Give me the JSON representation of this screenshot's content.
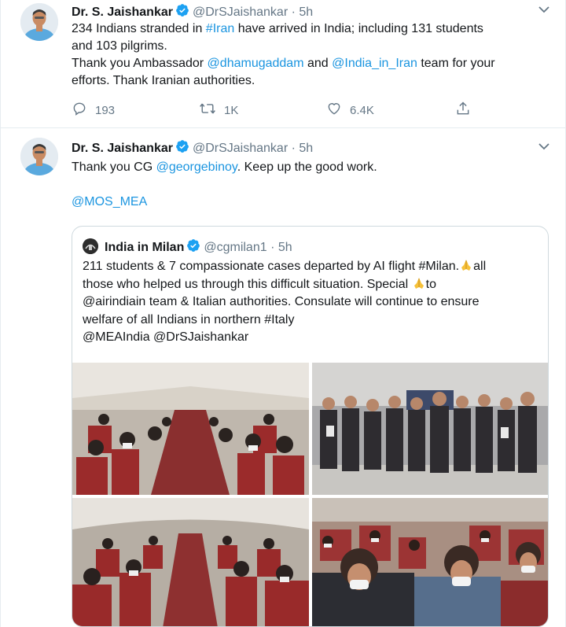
{
  "tweets": [
    {
      "name": "Dr. S. Jaishankar",
      "handle": "@DrSJaishankar",
      "dot": "·",
      "time": "5h",
      "text": {
        "line1_a": "234 Indians stranded in ",
        "line1_link": "#Iran",
        "line1_b": " have arrived in India; including 131 students",
        "line2": "and 103 pilgrims.",
        "line3_a": "Thank you Ambassador ",
        "line3_link1": "@dhamugaddam",
        "line3_b": " and ",
        "line3_link2": "@India_in_Iran",
        "line3_c": " team for your",
        "line4": "efforts. Thank Iranian authorities."
      },
      "actions": {
        "replies": "193",
        "retweets": "1K",
        "likes": "6.4K"
      }
    },
    {
      "name": "Dr. S. Jaishankar",
      "handle": "@DrSJaishankar",
      "dot": "·",
      "time": "5h",
      "text": {
        "line1_a": "Thank you CG ",
        "line1_link": "@georgebinoy",
        "line1_b": ". Keep up the good work.",
        "mention": "@MOS_MEA"
      }
    }
  ],
  "quote": {
    "name": "India in Milan",
    "handle": "@cgmilan1",
    "dot": "·",
    "time": "5h",
    "line1": "211 students & 7 compassionate cases departed by AI flight #Milan.",
    "line1_b": "all",
    "line2": "those who helped us through this difficult situation. Special ",
    "line2_b": "to",
    "line3": "@airindiain team & Italian authorities. Consulate will continue to ensure",
    "line4": "welfare of all Indians in northern #Italy",
    "line5": "@MEAIndia @DrSJaishankar"
  },
  "colors": {
    "link": "#1b95e0",
    "verified": "#1da1f2",
    "muted": "#657786"
  },
  "icons": [
    "verified-badge-icon",
    "chevron-down-icon",
    "reply-icon",
    "retweet-icon",
    "like-icon",
    "share-icon",
    "folded-hands-emoji-icon"
  ]
}
